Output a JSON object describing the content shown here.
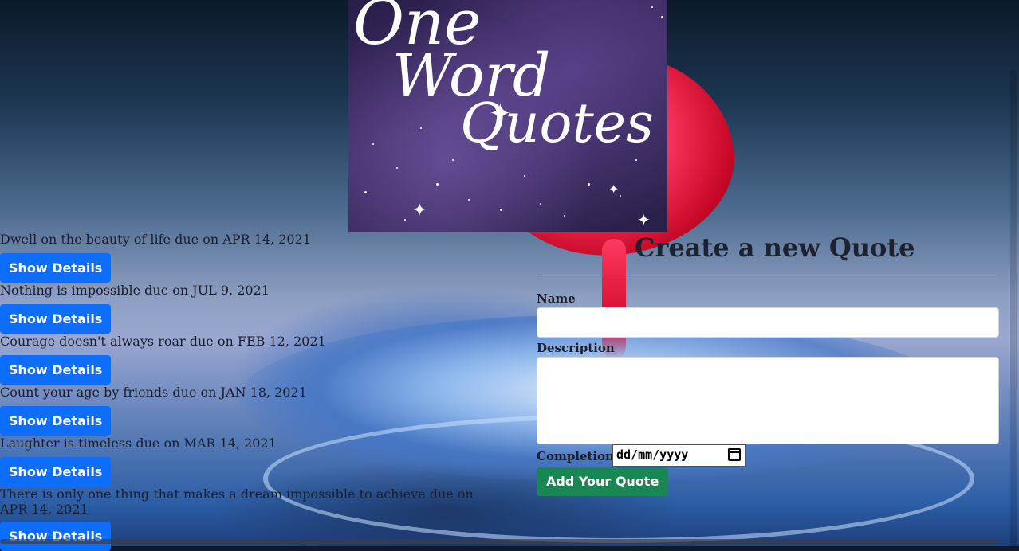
{
  "logo": {
    "line1": "One",
    "line2": "Word",
    "line3": "Quotes"
  },
  "quotes": [
    {
      "text": "Dwell on the beauty of life due on APR 14, 2021",
      "button": "Show Details"
    },
    {
      "text": "Nothing is impossible due on JUL 9, 2021",
      "button": "Show Details"
    },
    {
      "text": "Courage doesn't always roar due on FEB 12, 2021",
      "button": "Show Details"
    },
    {
      "text": "Count your age by friends due on JAN 18, 2021",
      "button": "Show Details"
    },
    {
      "text": "Laughter is timeless due on MAR 14, 2021",
      "button": "Show Details"
    },
    {
      "text": "There is only one thing that makes a dream impossible to achieve due on APR 14, 2021",
      "button": "Show Details"
    }
  ],
  "form": {
    "title": "Create a new Quote",
    "name_label": "Name",
    "description_label": "Description",
    "completion_label": "Completion",
    "date_placeholder": "dd/mm/yyyy",
    "submit_label": "Add Your Quote"
  },
  "colors": {
    "primary": "#0d6efd",
    "success": "#198754"
  }
}
